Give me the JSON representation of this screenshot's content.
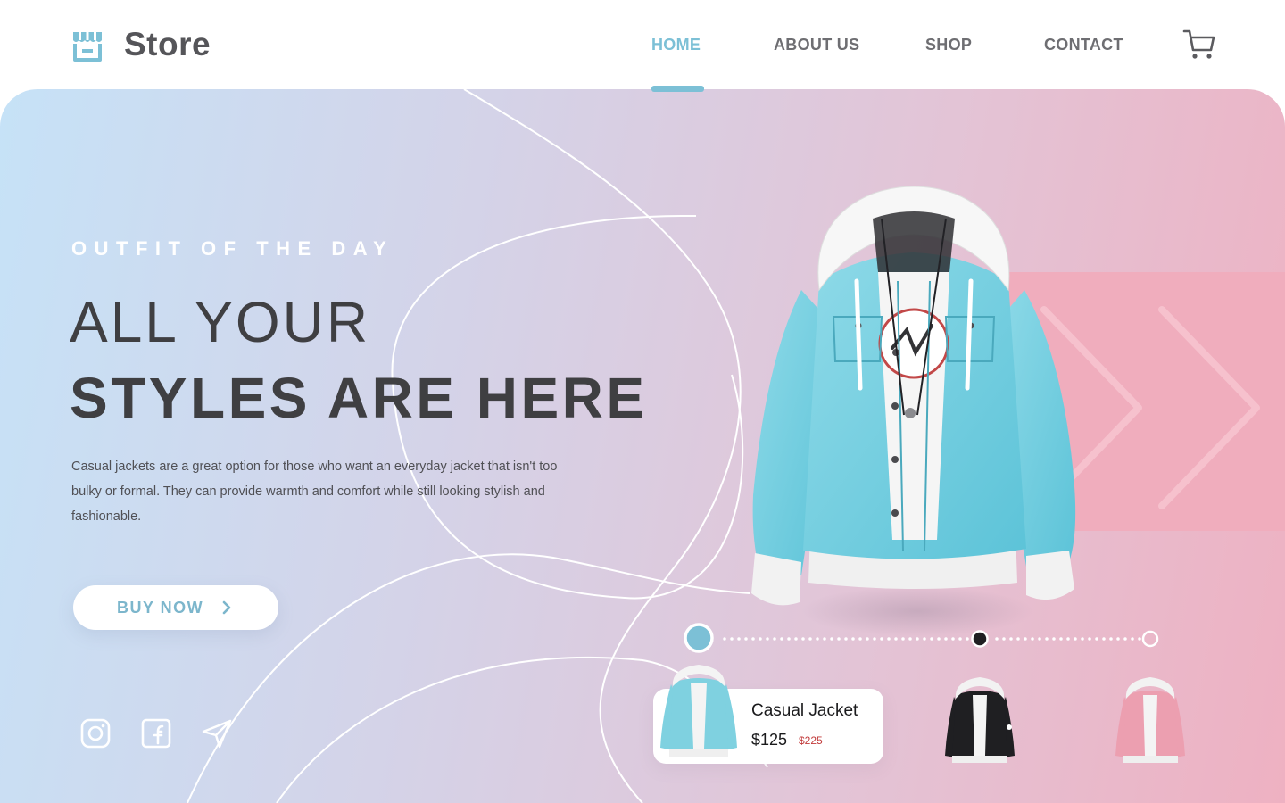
{
  "header": {
    "logo_text": "Store",
    "nav": [
      {
        "label": "HOME",
        "active": true
      },
      {
        "label": "ABOUT US",
        "active": false
      },
      {
        "label": "SHOP",
        "active": false
      },
      {
        "label": "CONTACT",
        "active": false
      }
    ],
    "cart_icon": "shopping-cart-icon"
  },
  "hero": {
    "eyebrow": "OUTFIT OF THE DAY",
    "title_line1": "ALL YOUR",
    "title_line2": "STYLES ARE HERE",
    "description": "Casual jackets are a great option for those who want an everyday jacket that isn't too bulky or formal. They can provide warmth and comfort while still looking stylish and fashionable.",
    "cta_label": "BUY NOW",
    "social_icons": [
      "instagram-icon",
      "facebook-icon",
      "send-icon"
    ]
  },
  "product": {
    "name": "Casual Jacket",
    "price": "$125",
    "old_price": "$225",
    "variants": [
      {
        "color": "light blue",
        "hex": "#7fd1e0",
        "selected": true
      },
      {
        "color": "black",
        "hex": "#1f1f22",
        "selected": false
      },
      {
        "color": "pink",
        "hex": "#ec9fb0",
        "selected": false
      }
    ]
  },
  "colors": {
    "accent": "#7cc0d6",
    "text_dark": "#3f3f42",
    "gradient_start": "#c6e2f7",
    "gradient_end": "#eeb1c2"
  }
}
